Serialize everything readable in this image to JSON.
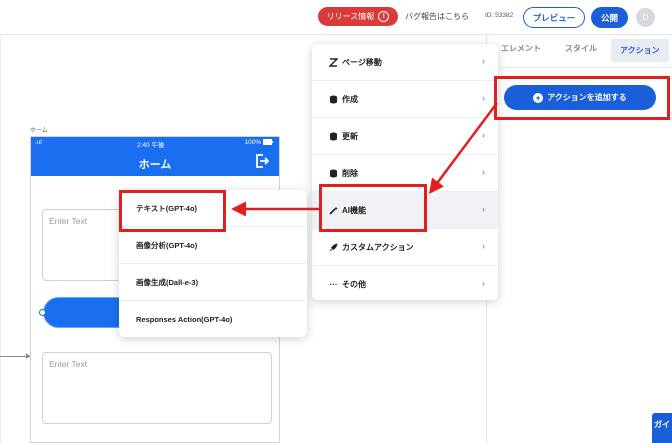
{
  "topbar": {
    "release_label": "リリース情報",
    "release_icon": "!",
    "bug_report": "バグ報告はこちら",
    "id_text": "ID: 53382",
    "preview_label": "プレビュー",
    "publish_label": "公開",
    "avatar_initial": "D"
  },
  "right_panel": {
    "tabs": [
      "エレメント",
      "スタイル",
      "アクション"
    ],
    "active_tab": "アクション",
    "add_action_label": "アクションを追加する",
    "guide_label": "ガイ"
  },
  "canvas": {
    "page_label": "ホーム",
    "status_time": "2:40 午後",
    "status_signal": ".ııl",
    "status_battery": "100%",
    "header_title": "ホーム",
    "input1_placeholder": "Enter Text",
    "input2_placeholder": "Enter Text"
  },
  "menu": {
    "items": [
      {
        "label": "ページ移動",
        "icon": "zigzag-icon"
      },
      {
        "label": "作成",
        "icon": "database-icon"
      },
      {
        "label": "更新",
        "icon": "database-icon"
      },
      {
        "label": "削除",
        "icon": "database-icon"
      },
      {
        "label": "AI機能",
        "icon": "magic-wand-icon"
      },
      {
        "label": "カスタムアクション",
        "icon": "rocket-icon"
      },
      {
        "label": "その他",
        "icon": "ellipsis-icon"
      }
    ],
    "highlighted": "AI機能"
  },
  "submenu": {
    "items": [
      "テキスト(GPT-4o)",
      "画像分析(GPT-4o)",
      "画像生成(Dall-e-3)",
      "Responses Action(GPT-4o)"
    ]
  },
  "colors": {
    "primary": "#1a5fd9",
    "phone_blue": "#1a6ff0",
    "release_red": "#d93a3a",
    "annotation_red": "#e02020"
  }
}
